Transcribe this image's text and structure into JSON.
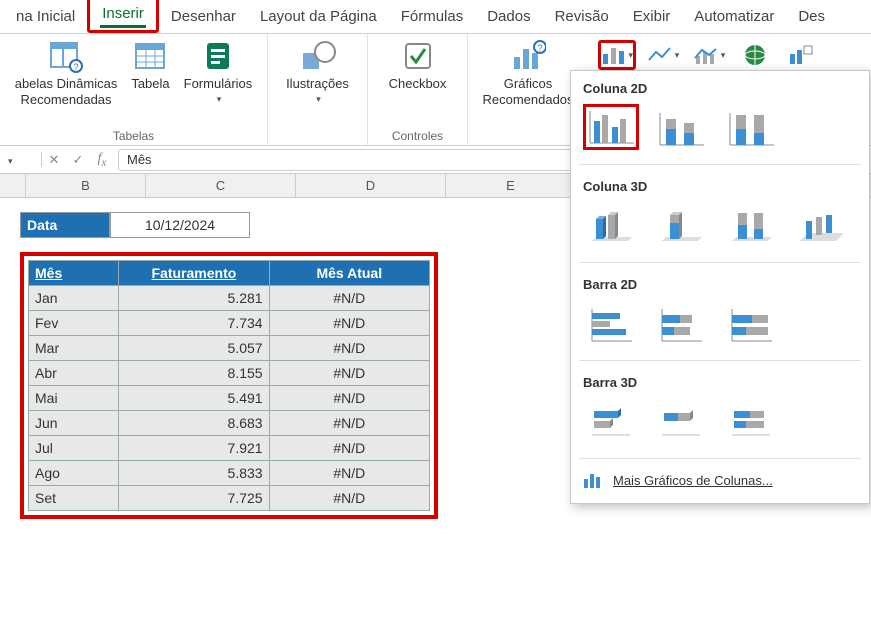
{
  "tabs": {
    "home": "na Inicial",
    "insert": "Inserir",
    "draw": "Desenhar",
    "layout": "Layout da Página",
    "formulas": "Fórmulas",
    "data": "Dados",
    "review": "Revisão",
    "view": "Exibir",
    "automate": "Automatizar",
    "dev": "Des"
  },
  "ribbon": {
    "pivot": "abelas Dinâmicas\nRecomendadas",
    "table": "Tabela",
    "forms": "Formulários",
    "group_tables": "Tabelas",
    "illustrations": "Ilustrações",
    "checkbox": "Checkbox",
    "group_controls": "Controles",
    "rec_charts": "Gráficos\nRecomendados"
  },
  "formula_bar": {
    "value": "Mês"
  },
  "columns": [
    "B",
    "C",
    "D",
    "E"
  ],
  "data_label": "Data",
  "data_value": "10/12/2024",
  "headers": {
    "mes": "Mês",
    "fat": "Faturamento",
    "atual": "Mês Atual"
  },
  "rows": [
    {
      "mes": "Jan",
      "fat": "5.281",
      "atual": "#N/D"
    },
    {
      "mes": "Fev",
      "fat": "7.734",
      "atual": "#N/D"
    },
    {
      "mes": "Mar",
      "fat": "5.057",
      "atual": "#N/D"
    },
    {
      "mes": "Abr",
      "fat": "8.155",
      "atual": "#N/D"
    },
    {
      "mes": "Mai",
      "fat": "5.491",
      "atual": "#N/D"
    },
    {
      "mes": "Jun",
      "fat": "8.683",
      "atual": "#N/D"
    },
    {
      "mes": "Jul",
      "fat": "7.921",
      "atual": "#N/D"
    },
    {
      "mes": "Ago",
      "fat": "5.833",
      "atual": "#N/D"
    },
    {
      "mes": "Set",
      "fat": "7.725",
      "atual": "#N/D"
    }
  ],
  "dropdown": {
    "col2d": "Coluna 2D",
    "col3d": "Coluna 3D",
    "bar2d": "Barra 2D",
    "bar3d": "Barra 3D",
    "more": "Mais Gráficos de Colunas..."
  },
  "colors": {
    "accent_blue": "#3b8fd4",
    "accent_gray": "#a9a9a9",
    "highlight_red": "#d40000",
    "header_blue": "#1f6fb3",
    "excel_green": "#0a6e32"
  }
}
